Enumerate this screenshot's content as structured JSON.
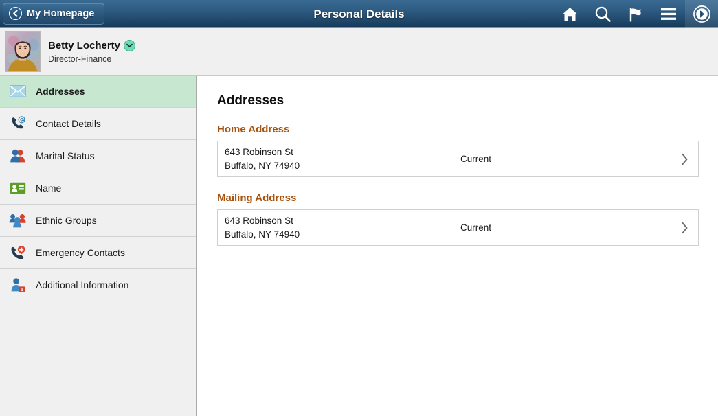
{
  "header": {
    "back_label": "My Homepage",
    "back_icon": "chevron-left-circle-icon",
    "title": "Personal Details",
    "icons": [
      {
        "name": "home-icon",
        "label": "Home"
      },
      {
        "name": "search-icon",
        "label": "Search"
      },
      {
        "name": "flag-icon",
        "label": "Notifications"
      },
      {
        "name": "hamburger-menu-icon",
        "label": "Actions"
      },
      {
        "name": "navbar-compass-icon",
        "label": "NavBar"
      }
    ],
    "accent_color": "#5b9bd5",
    "background_color": "#2f5d84"
  },
  "profile": {
    "name": "Betty Locherty",
    "role": "Director-Finance",
    "badge_icon": "chevron-down-circle-icon",
    "badge_color": "#6fdcb3",
    "avatar_alt": "Betty Locherty photo"
  },
  "sidebar": {
    "items": [
      {
        "label": "Addresses",
        "icon": "envelope-icon",
        "selected": true
      },
      {
        "label": "Contact Details",
        "icon": "phone-at-icon",
        "selected": false
      },
      {
        "label": "Marital Status",
        "icon": "two-people-icon",
        "selected": false
      },
      {
        "label": "Name",
        "icon": "id-card-icon",
        "selected": false
      },
      {
        "label": "Ethnic Groups",
        "icon": "group-people-icon",
        "selected": false
      },
      {
        "label": "Emergency Contacts",
        "icon": "phone-medical-icon",
        "selected": false
      },
      {
        "label": "Additional Information",
        "icon": "person-info-icon",
        "selected": false
      }
    ],
    "selected_background": "#c7e7d0",
    "background": "#f0f0f0"
  },
  "main": {
    "heading": "Addresses",
    "group_title_color": "#a85410",
    "sections": [
      {
        "title": "Home Address",
        "rows": [
          {
            "line1": "643 Robinson St",
            "line2": "Buffalo, NY 74940",
            "status": "Current",
            "chevron": "chevron-right-icon"
          }
        ]
      },
      {
        "title": "Mailing Address",
        "rows": [
          {
            "line1": "643 Robinson St",
            "line2": "Buffalo, NY 74940",
            "status": "Current",
            "chevron": "chevron-right-icon"
          }
        ]
      }
    ]
  }
}
